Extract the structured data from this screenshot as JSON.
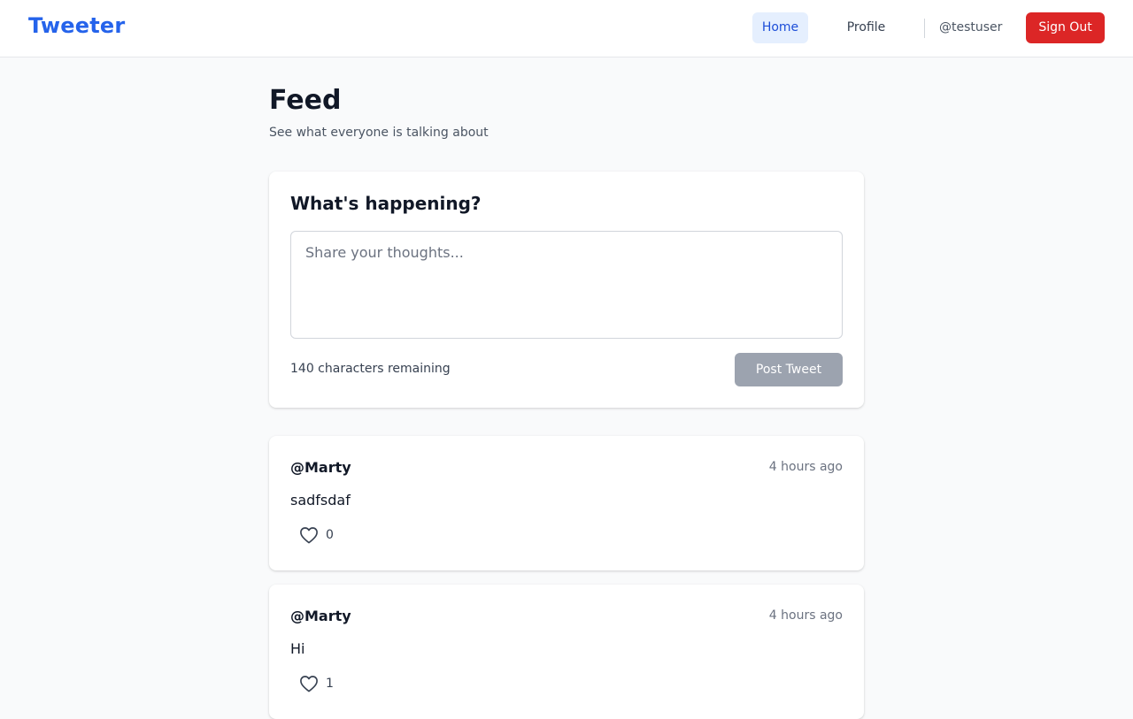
{
  "header": {
    "logo": "Tweeter",
    "nav": {
      "home": "Home",
      "profile": "Profile"
    },
    "username": "@testuser",
    "signout": "Sign Out"
  },
  "page": {
    "title": "Feed",
    "subtitle": "See what everyone is talking about"
  },
  "compose": {
    "title": "What's happening?",
    "placeholder": "Share your thoughts...",
    "value": "",
    "remaining": "140 characters remaining",
    "post_label": "Post Tweet"
  },
  "tweets": [
    {
      "user": "@Marty",
      "time": "4 hours ago",
      "body": "sadfsdaf",
      "likes": "0",
      "icon": "heart-icon"
    },
    {
      "user": "@Marty",
      "time": "4 hours ago",
      "body": "Hi",
      "likes": "1",
      "icon": "heart-icon"
    }
  ],
  "colors": {
    "brand": "#2563eb",
    "danger": "#dc2626",
    "disabled": "#9ca3af",
    "background": "#f9fafb"
  }
}
